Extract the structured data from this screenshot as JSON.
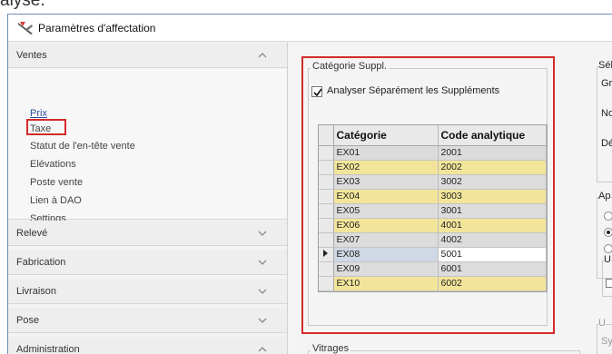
{
  "top_fragment": "alyse.",
  "window": {
    "title": "Paramètres d'affectation",
    "icon": "tools-icon"
  },
  "sidebar": {
    "sections": [
      {
        "label": "Ventes",
        "expanded": true,
        "items": [
          {
            "label": "Prix",
            "active": true
          },
          {
            "label": "Taxe"
          },
          {
            "label": "Statut de l'en-tête vente"
          },
          {
            "label": "Elévations"
          },
          {
            "label": "Poste vente"
          },
          {
            "label": "Lien à DAO"
          },
          {
            "label": "Settings"
          }
        ]
      },
      {
        "label": "Relevé",
        "expanded": false
      },
      {
        "label": "Fabrication",
        "expanded": false
      },
      {
        "label": "Livraison",
        "expanded": false
      },
      {
        "label": "Pose",
        "expanded": false
      },
      {
        "label": "Administration",
        "expanded": true
      }
    ]
  },
  "categorie_suppl": {
    "title": "Catégorie Suppl.",
    "checkbox_label": "Analyser Séparément les Suppléments",
    "checked": true,
    "columns": [
      "Catégorie",
      "Code analytique"
    ],
    "rows": [
      {
        "categorie": "EX01",
        "code": "2001"
      },
      {
        "categorie": "EX02",
        "code": "2002"
      },
      {
        "categorie": "EX03",
        "code": "3002"
      },
      {
        "categorie": "EX04",
        "code": "3003"
      },
      {
        "categorie": "EX05",
        "code": "3001"
      },
      {
        "categorie": "EX06",
        "code": "4001"
      },
      {
        "categorie": "EX07",
        "code": "4002"
      },
      {
        "categorie": "EX08",
        "code": "5001",
        "current": true
      },
      {
        "categorie": "EX09",
        "code": "6001"
      },
      {
        "categorie": "EX10",
        "code": "6002"
      }
    ],
    "row_colors": {
      "odd": "#dcdcdc",
      "even": "#f2e59a",
      "current": "#cfd8e4"
    }
  },
  "vitrages": {
    "title": "Vitrages"
  },
  "right_panel": {
    "group1_title": "Sél",
    "gro": "Gro",
    "no": "No.",
    "dec": "Déc",
    "group2_title": "Ap",
    "group3_title": "U",
    "group4_title": "U",
    "sy": "Sy"
  }
}
